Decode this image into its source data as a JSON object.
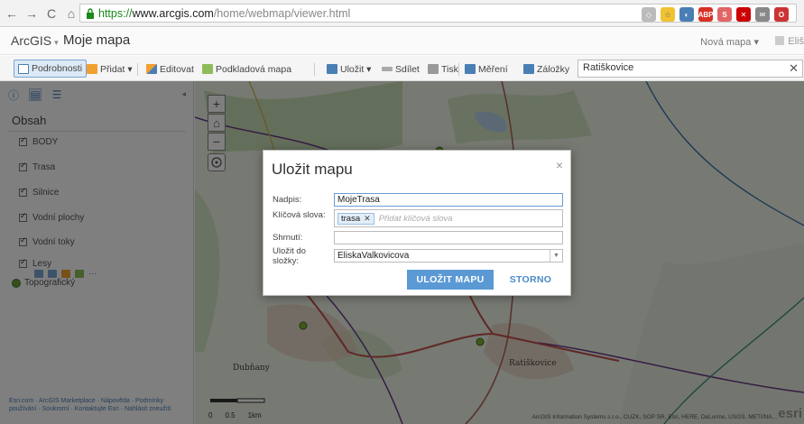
{
  "browser": {
    "url_scheme": "https://",
    "url_host": "www.arcgis.com",
    "url_path": "/home/webmap/viewer.html"
  },
  "header": {
    "brand": "ArcGIS",
    "map_title": "Moje mapa",
    "new_map": "Nová mapa ▾",
    "user": "Eliš"
  },
  "toolbar": {
    "details": "Podrobnosti",
    "add": "Přidat ▾",
    "edit": "Editovat",
    "basemap": "Podkladová mapa",
    "save": "Uložit ▾",
    "share": "Sdílet",
    "print": "Tisk",
    "measure": "Měření",
    "bookmarks": "Záložky",
    "search_value": "Ratiškovice"
  },
  "panel": {
    "title": "Obsah",
    "layers": [
      "BODY",
      "Trasa",
      "Silnice",
      "Vodní plochy",
      "Vodní toky",
      "Lesy"
    ],
    "basemap_layer": "Topografický",
    "footer": "Esri.com · ArcGIS Marketplace · Nápověda · Podmínky používání · Soukromí · Kontaktujte Esri · Nahlásit zneužití"
  },
  "map": {
    "labels": [
      "Dubňany",
      "Ratiškovice"
    ],
    "scale_labels": [
      "0",
      "0.5",
      "1km"
    ],
    "attribution": "ArcGIS Information Systems s.r.o., CUZK, SOP SR, Esri, HERE, DeLorme, USGS, METI/NA...",
    "logo": "esri"
  },
  "dialog": {
    "title": "Uložit mapu",
    "close": "×",
    "title_label": "Nadpis:",
    "title_value": "MojeTrasa",
    "keywords_label": "Klíčová slova:",
    "keyword_tag": "trasa",
    "keywords_placeholder": "Přidat klíčová slova",
    "summary_label": "Shrnutí:",
    "summary_value": "",
    "folder_label_1": "Uložit do",
    "folder_label_2": "složky:",
    "folder_value": "EliskaValkovicova",
    "save_button": "ULOŽIT MAPU",
    "cancel_button": "STORNO"
  },
  "colors": {
    "accent": "#5a99d4",
    "route": "#c0504d",
    "road": "#6a3a8a"
  }
}
